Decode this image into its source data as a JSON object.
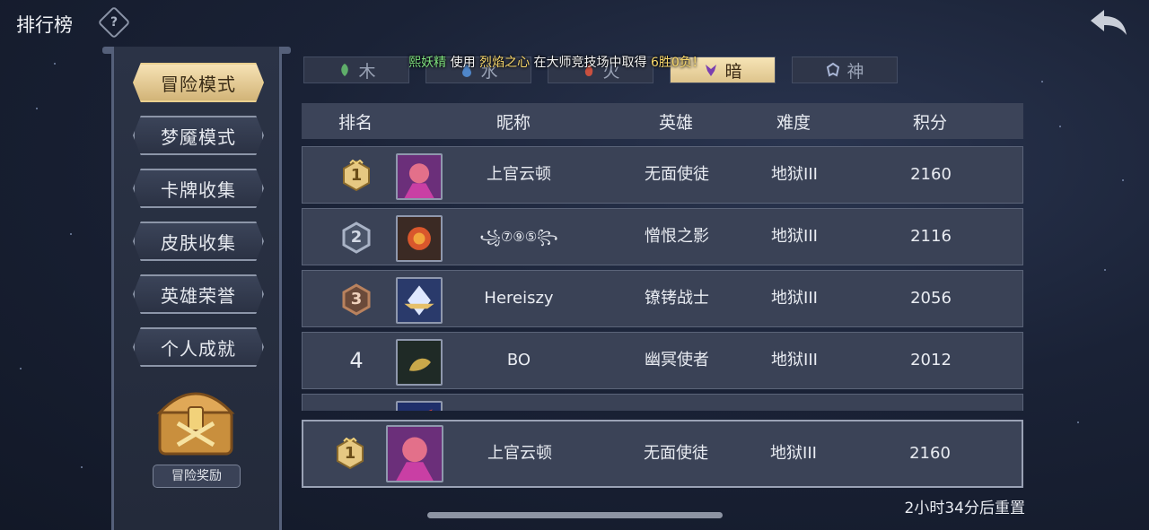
{
  "header": {
    "title": "排行榜"
  },
  "sidebar": {
    "items": [
      {
        "label": "冒险模式",
        "active": true
      },
      {
        "label": "梦魇模式",
        "active": false
      },
      {
        "label": "卡牌收集",
        "active": false
      },
      {
        "label": "皮肤收集",
        "active": false
      },
      {
        "label": "英雄荣誉",
        "active": false
      },
      {
        "label": "个人成就",
        "active": false
      }
    ],
    "reward_label": "冒险奖励"
  },
  "tabs": [
    {
      "label": "木",
      "active": false,
      "icon": "leaf-icon"
    },
    {
      "label": "水",
      "active": false,
      "icon": "water-icon"
    },
    {
      "label": "火",
      "active": false,
      "icon": "fire-icon"
    },
    {
      "label": "暗",
      "active": true,
      "icon": "dark-icon"
    },
    {
      "label": "神",
      "active": false,
      "icon": "divine-icon"
    }
  ],
  "ticker": {
    "player": "熙妖精",
    "verb": "使用",
    "hero": "烈焰之心",
    "middle": "在大师竞技场中取得",
    "result": "6胜0负！"
  },
  "table": {
    "headers": {
      "rank": "排名",
      "nickname": "昵称",
      "hero": "英雄",
      "difficulty": "难度",
      "score": "积分"
    },
    "rows": [
      {
        "rank": "1",
        "nickname": "上官云顿",
        "hero": "无面使徒",
        "difficulty": "地狱III",
        "score": "2160"
      },
      {
        "rank": "2",
        "nickname": "꧁⑦⑨⑤꧂",
        "hero": "憎恨之影",
        "difficulty": "地狱III",
        "score": "2116"
      },
      {
        "rank": "3",
        "nickname": "Hereiszy",
        "hero": "镣铐战士",
        "difficulty": "地狱III",
        "score": "2056"
      },
      {
        "rank": "4",
        "nickname": "BO",
        "hero": "幽冥使者",
        "difficulty": "地狱III",
        "score": "2012"
      }
    ]
  },
  "my_rank": {
    "rank": "1",
    "nickname": "上官云顿",
    "hero": "无面使徒",
    "difficulty": "地狱III",
    "score": "2160"
  },
  "reset_text": "2小时34分后重置",
  "colors": {
    "gold": "#e9cf8f",
    "silver": "#a9b3c6",
    "bronze": "#b9825e",
    "accent_green": "#7ee07e",
    "accent_yellow": "#f6d66a"
  }
}
